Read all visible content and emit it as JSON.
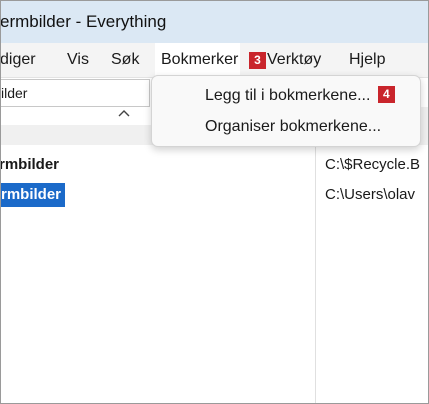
{
  "window": {
    "title": "ermbilder - Everything"
  },
  "menubar": {
    "items": [
      {
        "label": "diger"
      },
      {
        "label": "Vis"
      },
      {
        "label": "Søk"
      },
      {
        "label": "Bokmerker"
      },
      {
        "label": "Verktøy"
      },
      {
        "label": "Hjelp"
      }
    ],
    "open_menu": "Bokmerker",
    "step_badge_menu": "3"
  },
  "search": {
    "value": "ilder"
  },
  "results": {
    "names": [
      "rmbilder",
      "rmbilder"
    ],
    "paths": [
      "C:\\$Recycle.B",
      "C:\\Users\\olav"
    ],
    "selected_index": 1
  },
  "bookmarks_menu": {
    "items": [
      {
        "label": "Legg til i bokmerkene..."
      },
      {
        "label": "Organiser bokmerkene..."
      }
    ],
    "step_badge_item": "4"
  },
  "colors": {
    "titlebar": "#dbe8f4",
    "menubar": "#f4f4f4",
    "selection": "#1b6ac9",
    "badge": "#c9252c"
  },
  "icons": {
    "sort": "chevron-up-icon"
  }
}
